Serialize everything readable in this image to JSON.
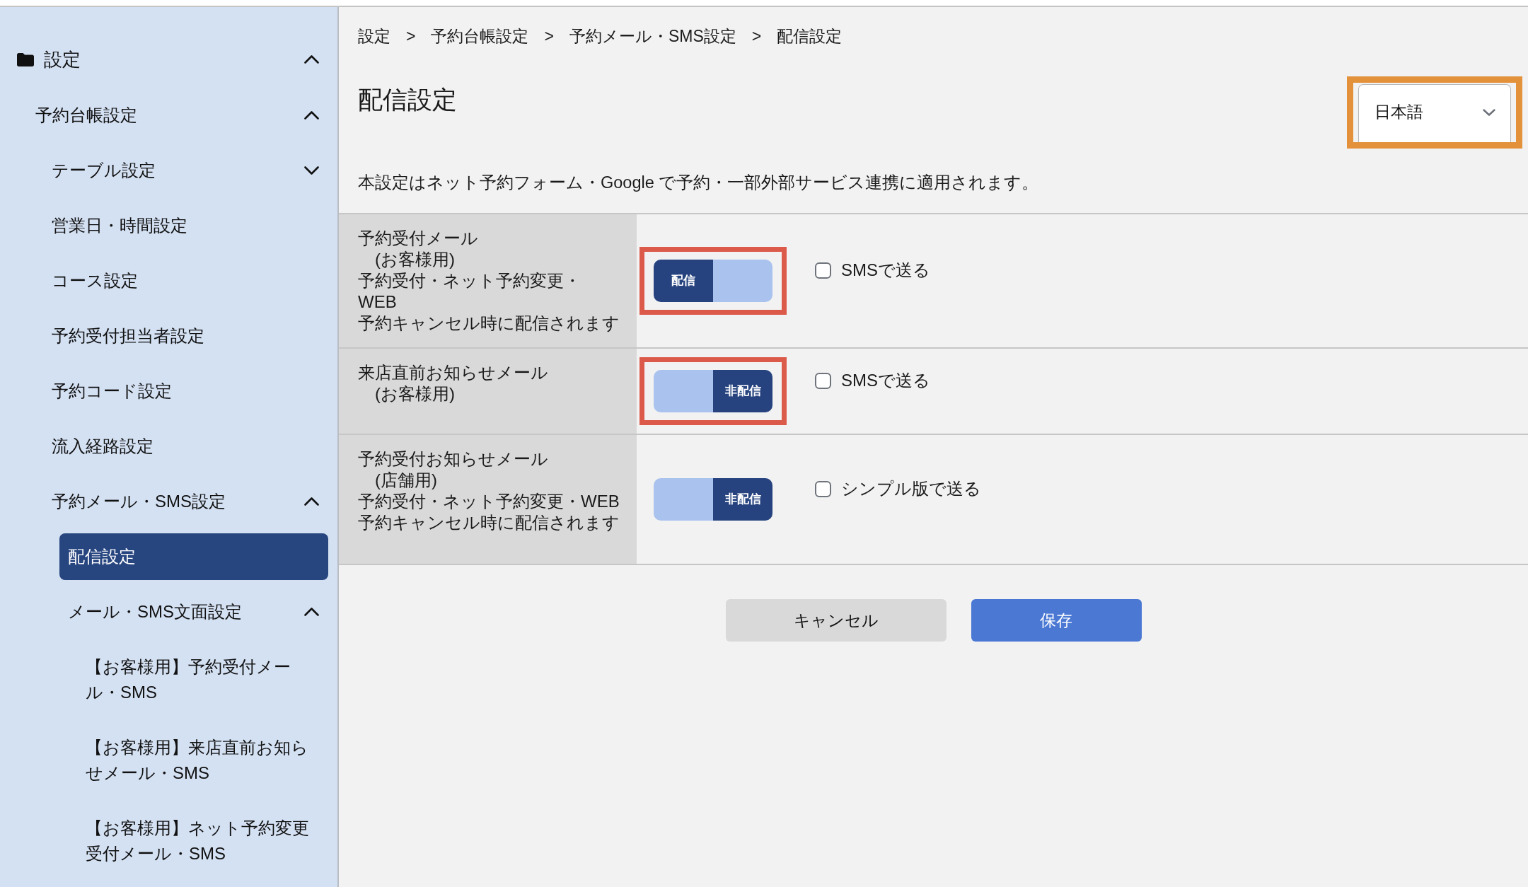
{
  "sidebar": {
    "items": [
      {
        "kind": "folder",
        "label": "設定",
        "selected": false,
        "expanded": true,
        "children": [
          {
            "kind": "group",
            "label": "予約台帳設定",
            "selected": false,
            "expanded": true,
            "children": [
              {
                "kind": "group",
                "label": "テーブル設定",
                "selected": false,
                "expanded": false
              },
              {
                "kind": "page",
                "label": "営業日・時間設定",
                "selected": false
              },
              {
                "kind": "page",
                "label": "コース設定",
                "selected": false
              },
              {
                "kind": "page",
                "label": "予約受付担当者設定",
                "selected": false
              },
              {
                "kind": "page",
                "label": "予約コード設定",
                "selected": false
              },
              {
                "kind": "page",
                "label": "流入経路設定",
                "selected": false
              },
              {
                "kind": "group",
                "label": "予約メール・SMS設定",
                "selected": false,
                "expanded": true,
                "children": [
                  {
                    "kind": "page",
                    "label": "配信設定",
                    "selected": true
                  },
                  {
                    "kind": "group",
                    "label": "メール・SMS文面設定",
                    "selected": false,
                    "expanded": true,
                    "children": [
                      {
                        "kind": "page",
                        "label": "【お客様用】予約受付メール・SMS",
                        "selected": false
                      },
                      {
                        "kind": "page",
                        "label": "【お客様用】来店直前お知らせメール・SMS",
                        "selected": false
                      },
                      {
                        "kind": "page",
                        "label": "【お客様用】ネット予約変更受付メール・SMS",
                        "selected": false
                      }
                    ]
                  }
                ]
              }
            ]
          }
        ]
      }
    ]
  },
  "breadcrumb": [
    {
      "kind": "link",
      "label": "設定"
    },
    {
      "kind": "separator",
      "label": ">"
    },
    {
      "kind": "link",
      "label": "予約台帳設定"
    },
    {
      "kind": "separator",
      "label": ">"
    },
    {
      "kind": "link",
      "label": "予約メール・SMS設定"
    },
    {
      "kind": "separator",
      "label": ">"
    },
    {
      "kind": "current",
      "label": "配信設定"
    }
  ],
  "page_title": "配信設定",
  "language_select": {
    "value": "日本語",
    "highlighted": true
  },
  "description": "本設定はネット予約フォーム・Google で予約・一部外部サービス連携に適用されます。",
  "rows": [
    {
      "title": "予約受付メール",
      "audience": "(お客様用)",
      "description_lines": [
        "予約受付・ネット予約変更・",
        "WEB",
        "予約キャンセル時に配信されます"
      ],
      "delivery": {
        "on": true,
        "label": "配信"
      },
      "highlighted": true,
      "option": {
        "label": "SMSで送る",
        "checked": false
      }
    },
    {
      "title": "来店直前お知らせメール",
      "audience": "(お客様用)",
      "delivery": {
        "on": false,
        "label": "非配信"
      },
      "highlighted": true,
      "option": {
        "label": "SMSで送る",
        "checked": false
      }
    },
    {
      "title": "予約受付お知らせメール",
      "audience": "(店舗用)",
      "description_lines": [
        "予約受付・ネット予約変更・WEB",
        "予約キャンセル時に配信されます"
      ],
      "delivery": {
        "on": false,
        "label": "非配信"
      },
      "highlighted": false,
      "option": {
        "label": "シンプル版で送る",
        "checked": false
      }
    }
  ],
  "buttons": [
    {
      "kind": "secondary",
      "label": "キャンセル"
    },
    {
      "kind": "primary",
      "label": "保存"
    }
  ]
}
